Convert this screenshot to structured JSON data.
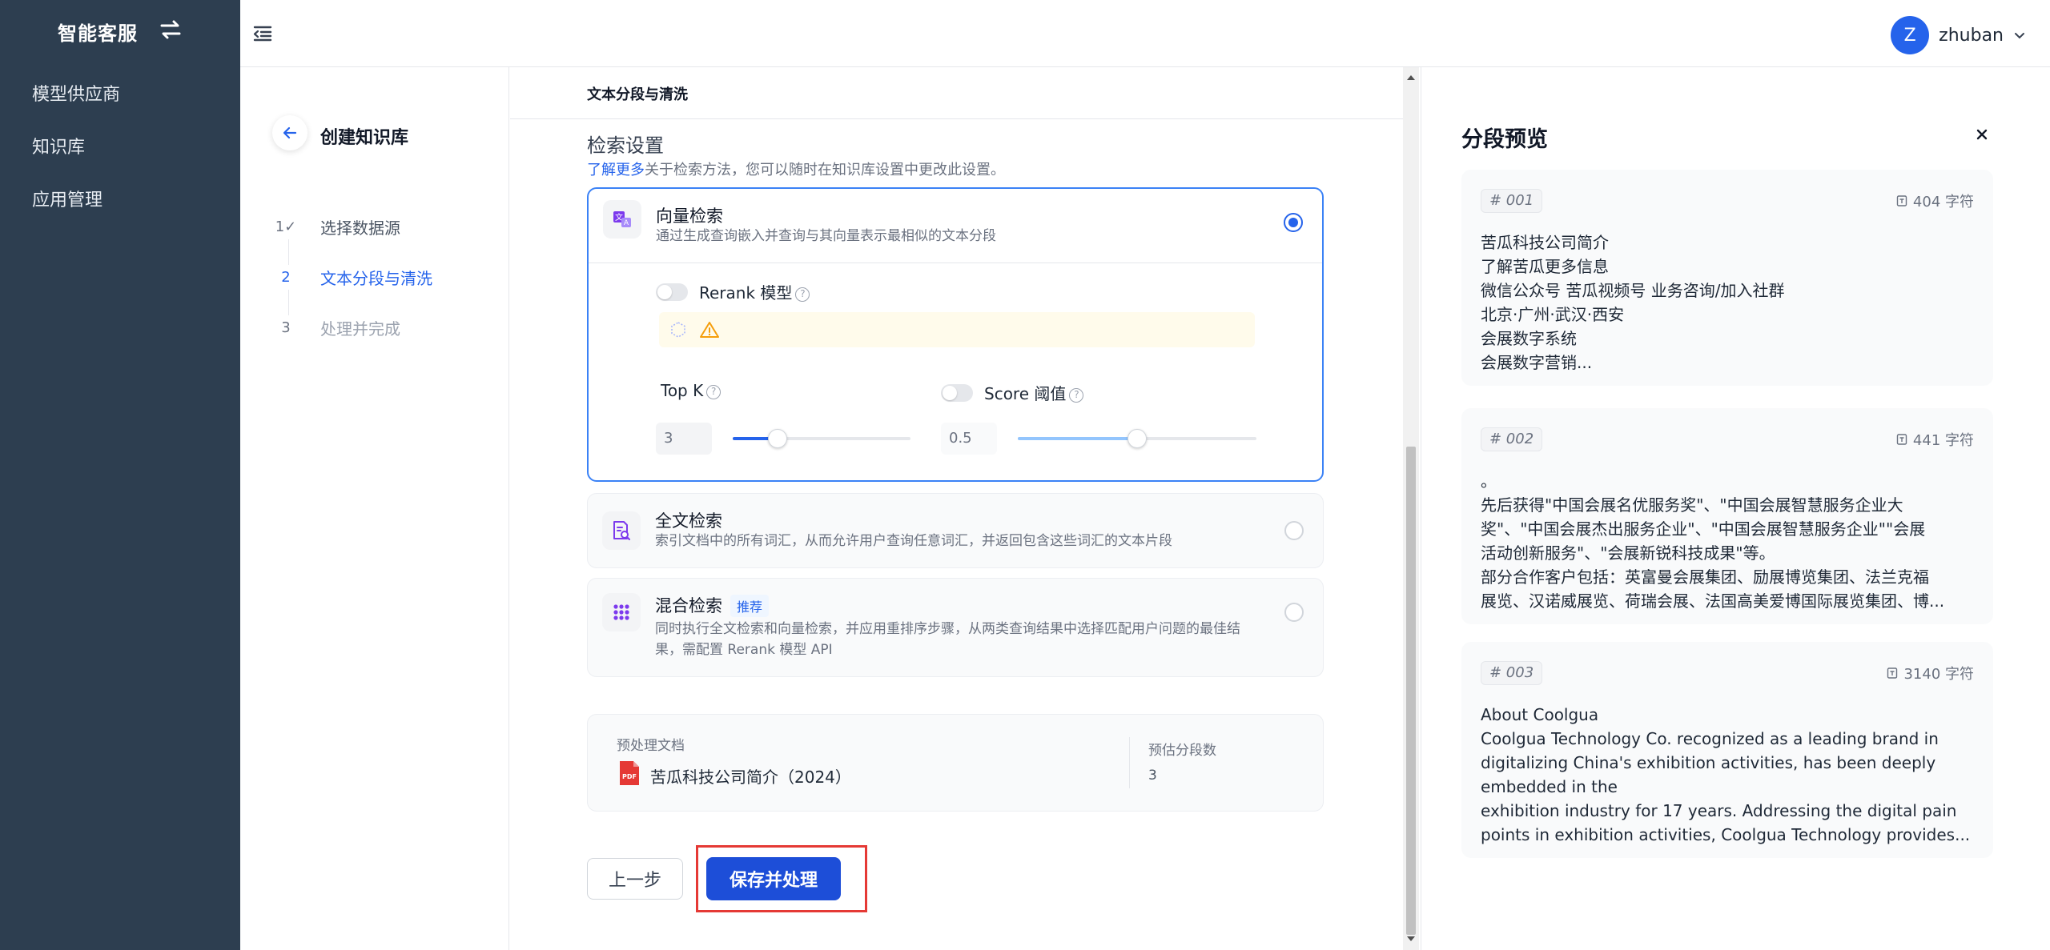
{
  "sidebar": {
    "brand": "智能客服",
    "items": [
      {
        "label": "模型供应商"
      },
      {
        "label": "知识库"
      },
      {
        "label": "应用管理"
      }
    ]
  },
  "topbar": {
    "user": {
      "avatar_letter": "Z",
      "name": "zhuban"
    }
  },
  "steps": {
    "title": "创建知识库",
    "items": [
      {
        "num": "1✓",
        "label": "选择数据源"
      },
      {
        "num": "2",
        "label": "文本分段与清洗"
      },
      {
        "num": "3",
        "label": "处理并完成"
      }
    ]
  },
  "main": {
    "section_head": "文本分段与清洗",
    "retrieval": {
      "title": "检索设置",
      "desc_link": "了解更多",
      "desc_text": "关于检索方法，您可以随时在知识库设置中更改此设置。",
      "vector": {
        "title": "向量检索",
        "desc": "通过生成查询嵌入并查询与其向量表示最相似的文本分段",
        "rerank_label": "Rerank 模型",
        "topk_label": "Top K",
        "topk_value": "3",
        "topk_fraction": 0.25,
        "score_label": "Score 阈值",
        "score_value": "0.5",
        "score_fraction": 0.5
      },
      "fulltext": {
        "title": "全文检索",
        "desc": "索引文档中的所有词汇，从而允许用户查询任意词汇，并返回包含这些词汇的文本片段"
      },
      "hybrid": {
        "title": "混合检索",
        "tag": "推荐",
        "desc1": "同时执行全文检索和向量检索，并应用重排序步骤，从两类查询结果中选择匹配用户问题的最佳结",
        "desc2": "果，需配置 Rerank 模型 API"
      }
    },
    "pre": {
      "doc_label": "预处理文档",
      "doc_name": "苦瓜科技公司简介（2024）",
      "count_label": "预估分段数",
      "count_value": "3"
    },
    "buttons": {
      "prev": "上一步",
      "save": "保存并处理"
    }
  },
  "preview": {
    "title": "分段预览",
    "chunks": [
      {
        "id": "# 001",
        "count": "404 字符",
        "lines": [
          "苦瓜科技公司简介",
          "了解苦瓜更多信息",
          "微信公众号 苦瓜视频号 业务咨询/加入社群",
          "北京·广州·武汉·西安",
          "会展数字系统",
          "会展数字营销..."
        ]
      },
      {
        "id": "# 002",
        "count": "441 字符",
        "lines": [
          "。",
          "先后获得\"中国会展名优服务奖\"、\"中国会展智慧服务企业大",
          "奖\"、\"中国会展杰出服务企业\"、\"中国会展智慧服务企业\"\"会展",
          "活动创新服务\"、\"会展新锐科技成果\"等。",
          "部分合作客户包括：英富曼会展集团、励展博览集团、法兰克福",
          "展览、汉诺威展览、荷瑞会展、法国高美爱博国际展览集团、博..."
        ]
      },
      {
        "id": "# 003",
        "count": "3140 字符",
        "lines": [
          "About Coolgua",
          "Coolgua Technology Co. recognized as a leading brand in",
          "digitalizing China's exhibition activities, has been deeply",
          "embedded in the",
          "exhibition industry for 17 years. Addressing the digital pain",
          "points in exhibition activities, Coolgua Technology provides..."
        ]
      }
    ]
  }
}
